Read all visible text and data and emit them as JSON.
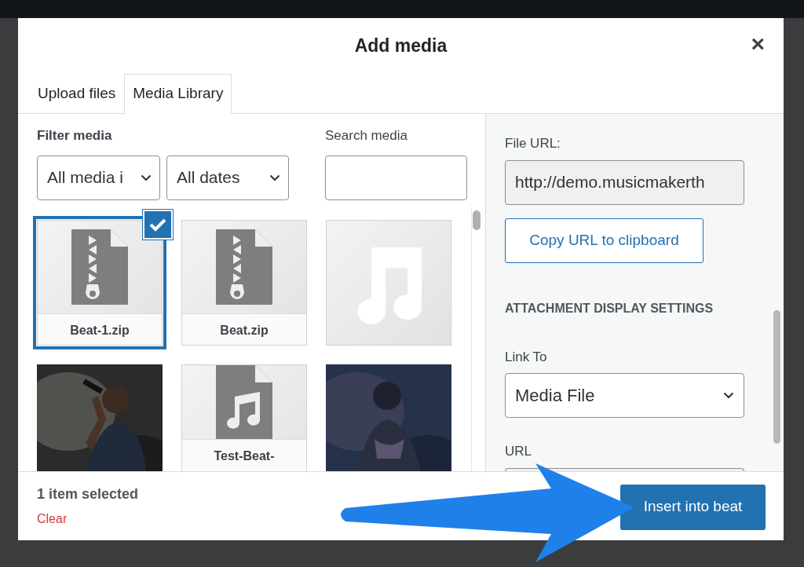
{
  "dialog": {
    "title": "Add media",
    "close": "×"
  },
  "tabs": [
    {
      "label": "Upload files",
      "selected": false
    },
    {
      "label": "Media Library",
      "selected": true
    }
  ],
  "filters": {
    "label": "Filter media",
    "type_select": "All media i",
    "date_select": "All dates"
  },
  "search": {
    "label": "Search media"
  },
  "media": [
    {
      "kind": "zip",
      "label": "Beat-1.zip",
      "selected": true
    },
    {
      "kind": "zip",
      "label": "Beat.zip",
      "selected": false
    },
    {
      "kind": "audio",
      "selected": false
    },
    {
      "kind": "picture",
      "selected": false
    },
    {
      "kind": "audio-file",
      "label": "Test-Beat-",
      "selected": false
    },
    {
      "kind": "picture",
      "selected": false
    }
  ],
  "details": {
    "file_url_label": "File URL:",
    "file_url": "http://demo.musicmakerth",
    "copy_button": "Copy URL to clipboard",
    "section_title": "ATTACHMENT DISPLAY SETTINGS",
    "link_to_label": "Link To",
    "link_to": "Media File",
    "url_label": "URL"
  },
  "footer": {
    "selection_count": "1 item selected",
    "clear": "Clear",
    "insert_button": "Insert into beat"
  }
}
